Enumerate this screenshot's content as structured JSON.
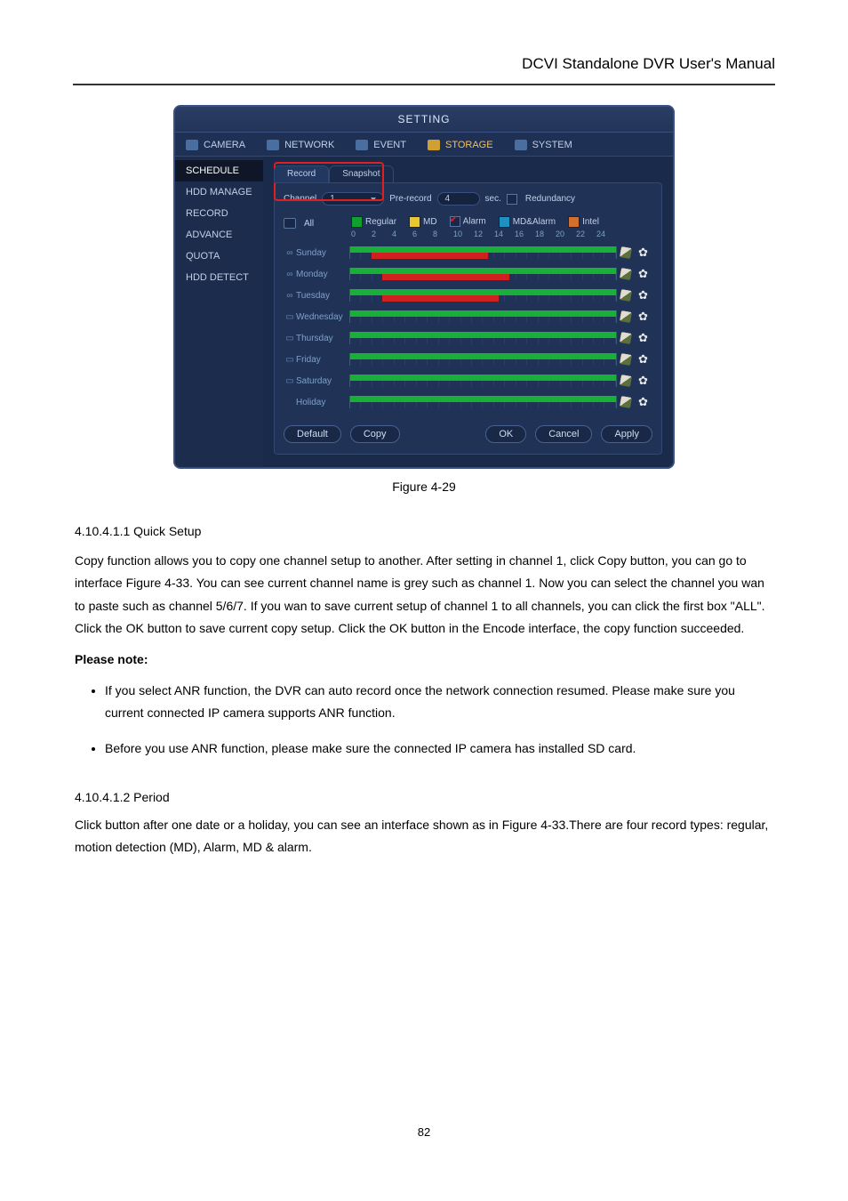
{
  "header_title": "DCVI Standalone DVR User's Manual",
  "app": {
    "title": "SETTING",
    "top_tabs": [
      "CAMERA",
      "NETWORK",
      "EVENT",
      "STORAGE",
      "SYSTEM"
    ],
    "sidebar": [
      "SCHEDULE",
      "HDD MANAGE",
      "RECORD",
      "ADVANCE",
      "QUOTA",
      "HDD DETECT"
    ],
    "sub_tabs": [
      "Record",
      "Snapshot"
    ],
    "row1": {
      "channel_label": "Channel",
      "channel_value": "1",
      "prerecord_label": "Pre-record",
      "prerecord_value": "4",
      "sec_label": "sec.",
      "redundancy_label": "Redundancy"
    },
    "all_label": "All",
    "legend": {
      "regular": "Regular",
      "md": "MD",
      "alarm": "Alarm",
      "mdalarm": "MD&Alarm",
      "intel": "Intel"
    },
    "axis": [
      "0",
      "2",
      "4",
      "6",
      "8",
      "10",
      "12",
      "14",
      "16",
      "18",
      "20",
      "22",
      "24"
    ],
    "days": [
      "Sunday",
      "Monday",
      "Tuesday",
      "Wednesday",
      "Thursday",
      "Friday",
      "Saturday",
      "Holiday"
    ],
    "day_locks": [
      "∞",
      "∞",
      "∞",
      "▭",
      "▭",
      "▭",
      "▭",
      ""
    ],
    "buttons": {
      "default": "Default",
      "copy": "Copy",
      "ok": "OK",
      "cancel": "Cancel",
      "apply": "Apply"
    }
  },
  "figure_caption": "Figure 4-29",
  "prose": {
    "subtitle": "4.10.4.1.1 Quick Setup",
    "intro": "Copy function allows you to copy one channel setup to another. After setting in channel 1, click Copy button, you can go to interface Figure 4-33. You can see current channel name is grey such as channel 1. Now you can select the channel you wan to paste such as channel 5/6/7. If you wan to save current setup of channel 1 to all channels, you can click the first box \"ALL\". Click the OK button to save current copy setup. Click the OK button in the Encode interface, the copy function succeeded.",
    "note_label": "Please note:",
    "bullets": [
      "If you select ANR function, the DVR can auto record once the network connection resumed. Please make sure you current connected IP camera supports ANR function.",
      "Before you use ANR function, please make sure the connected IP camera has installed SD card."
    ]
  },
  "period": {
    "title": "4.10.4.1.2 Period",
    "text": "Click  button after one date or a holiday, you can see an interface shown as in Figure 4-33.There are four record types: regular, motion detection (MD), Alarm, MD & alarm."
  },
  "page_number": "82"
}
